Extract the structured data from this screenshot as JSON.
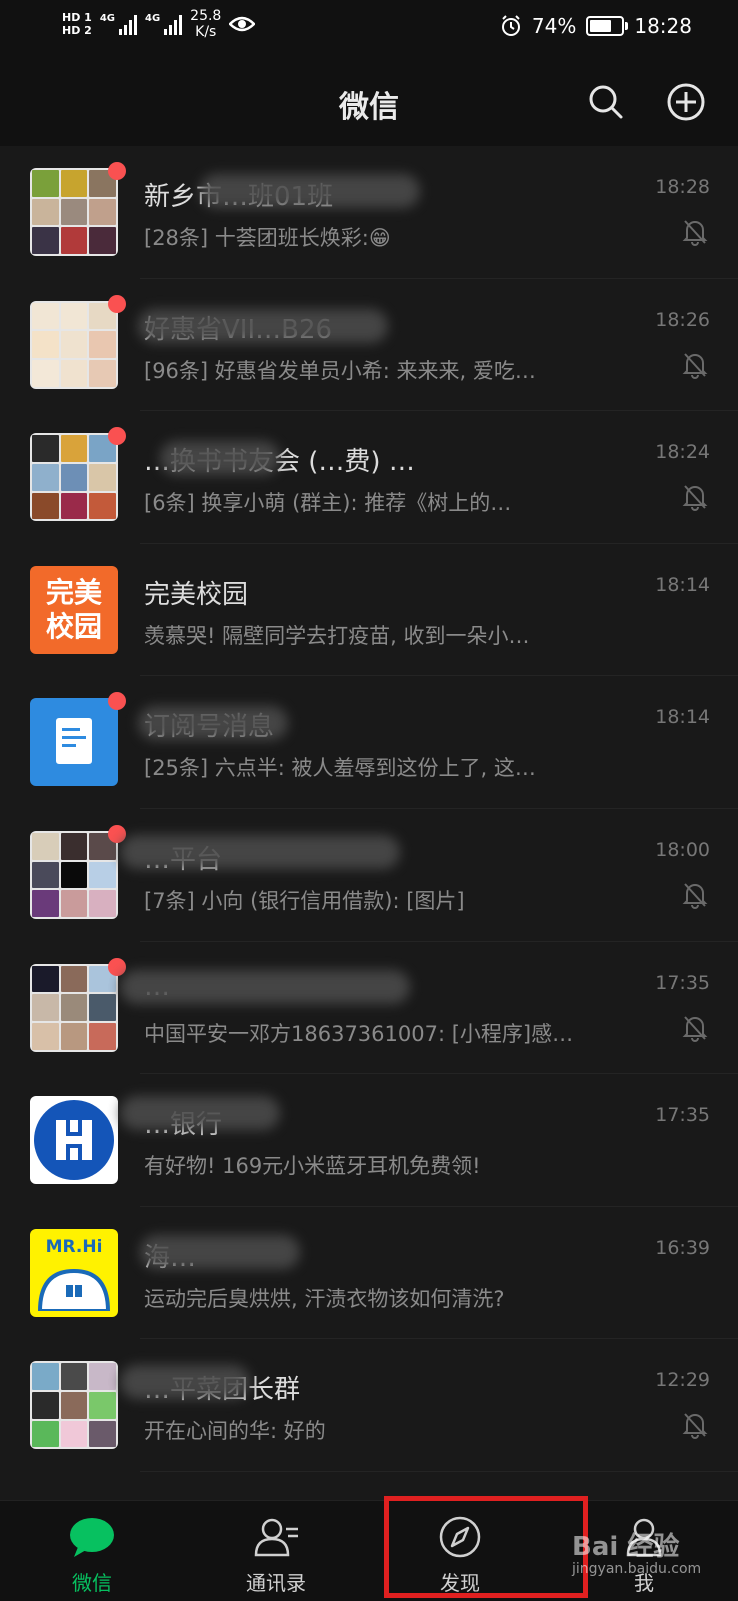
{
  "status_bar": {
    "hd1": "HD 1",
    "hd2": "HD 2",
    "sig1": "4G",
    "sig2": "4G",
    "speed_value": "25.8",
    "speed_unit": "K/s",
    "battery": "74%",
    "battery_level": 0.74,
    "time": "18:28"
  },
  "header": {
    "title": "微信",
    "search_icon": "search-icon",
    "add_icon": "plus-circle-icon"
  },
  "chats": [
    {
      "name": "新乡市…班01班",
      "preview": "[28条] 十荟团班长焕彩:😁",
      "time": "18:28",
      "unread": true,
      "muted": true
    },
    {
      "name": "好惠省VII…B26",
      "preview": "[96条] 好惠省发单员小希: 来来来, 爱吃…",
      "time": "18:26",
      "unread": true,
      "muted": true
    },
    {
      "name": "…换书书友会 (…费) …",
      "preview": "[6条] 换享小萌 (群主): 推荐《树上的…",
      "time": "18:24",
      "unread": true,
      "muted": true
    },
    {
      "name": "完美校园",
      "preview": "羡慕哭! 隔壁同学去打疫苗, 收到一朵小…",
      "time": "18:14",
      "unread": false,
      "muted": false
    },
    {
      "name": "订阅号消息",
      "preview": "[25条] 六点半: 被人羞辱到这份上了, 这…",
      "time": "18:14",
      "unread": true,
      "muted": false
    },
    {
      "name": "…平台",
      "preview": "[7条] 小向 (银行信用借款): [图片]",
      "time": "18:00",
      "unread": true,
      "muted": true
    },
    {
      "name": "…",
      "preview": "中国平安一邓方18637361007: [小程序]感…",
      "time": "17:35",
      "unread": true,
      "muted": true
    },
    {
      "name": "…银行",
      "preview": "有好物! 169元小米蓝牙耳机免费领!",
      "time": "17:35",
      "unread": false,
      "muted": false
    },
    {
      "name": "海…",
      "preview": "运动完后臭烘烘, 汗渍衣物该如何清洗?",
      "time": "16:39",
      "unread": false,
      "muted": false
    },
    {
      "name": "…平菜团长群",
      "preview": "开在心间的华: 好的",
      "time": "12:29",
      "unread": false,
      "muted": true
    }
  ],
  "tabs": [
    {
      "label": "微信",
      "icon": "chat-bubble-icon",
      "active": true
    },
    {
      "label": "通讯录",
      "icon": "contacts-icon",
      "active": false
    },
    {
      "label": "发现",
      "icon": "compass-icon",
      "active": false
    },
    {
      "label": "我",
      "icon": "person-icon",
      "active": false
    }
  ],
  "avatar_texts": {
    "wanmei": "完美校园",
    "mrhi": "MR.Hi"
  },
  "watermark": {
    "brand": "Bai 经验",
    "url": "jingyan.baidu.com"
  },
  "colors": {
    "accent": "#07c160",
    "badge": "#fa5151",
    "highlight": "#e02020"
  }
}
